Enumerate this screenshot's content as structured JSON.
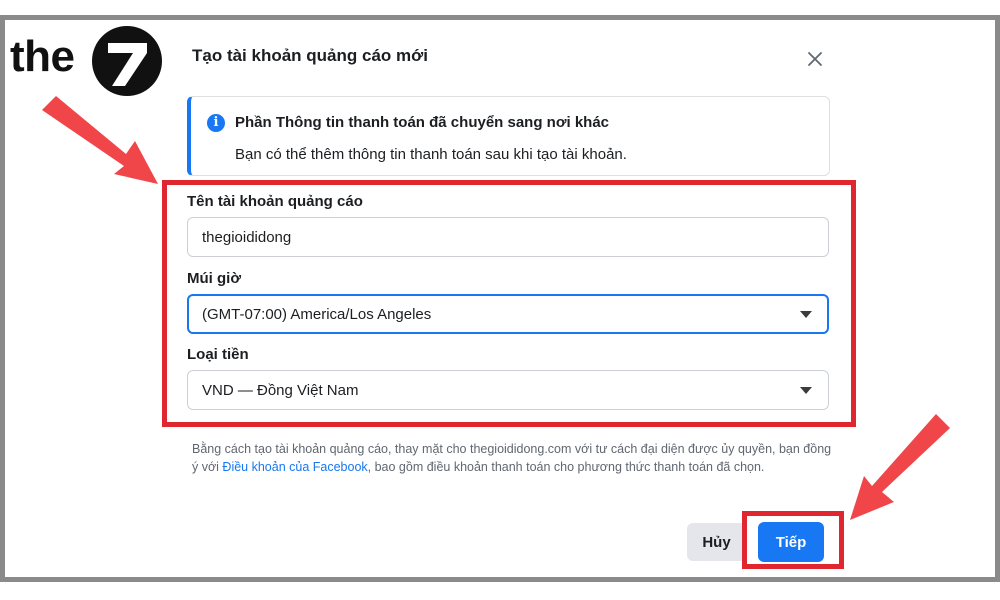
{
  "logo": {
    "text": "the",
    "mark": "7"
  },
  "dialog": {
    "title": "Tạo tài khoản quảng cáo mới",
    "close_icon": "close-icon"
  },
  "notice": {
    "icon": "info-icon",
    "title": "Phần Thông tin thanh toán đã chuyển sang nơi khác",
    "body": "Bạn có thể thêm thông tin thanh toán sau khi tạo tài khoản."
  },
  "form": {
    "account_name": {
      "label": "Tên tài khoản quảng cáo",
      "value": "thegioididong"
    },
    "timezone": {
      "label": "Múi giờ",
      "value": "(GMT-07:00) America/Los Angeles"
    },
    "currency": {
      "label": "Loại tiền",
      "value": "VND — Đồng Việt Nam"
    }
  },
  "legal": {
    "text_before": "Bằng cách tạo tài khoản quảng cáo, thay mặt cho thegioididong.com với tư cách đại diện được ủy quyền, bạn đồng ý với ",
    "link": "Điều khoản của Facebook",
    "text_after": ", bao gồm điều khoản thanh toán cho phương thức thanh toán đã chọn."
  },
  "buttons": {
    "cancel": "Hủy",
    "next": "Tiếp"
  },
  "colors": {
    "accent": "#1877f2",
    "highlight": "#e0262f",
    "arrow": "#f0464a",
    "frame": "#8a8a8a"
  }
}
